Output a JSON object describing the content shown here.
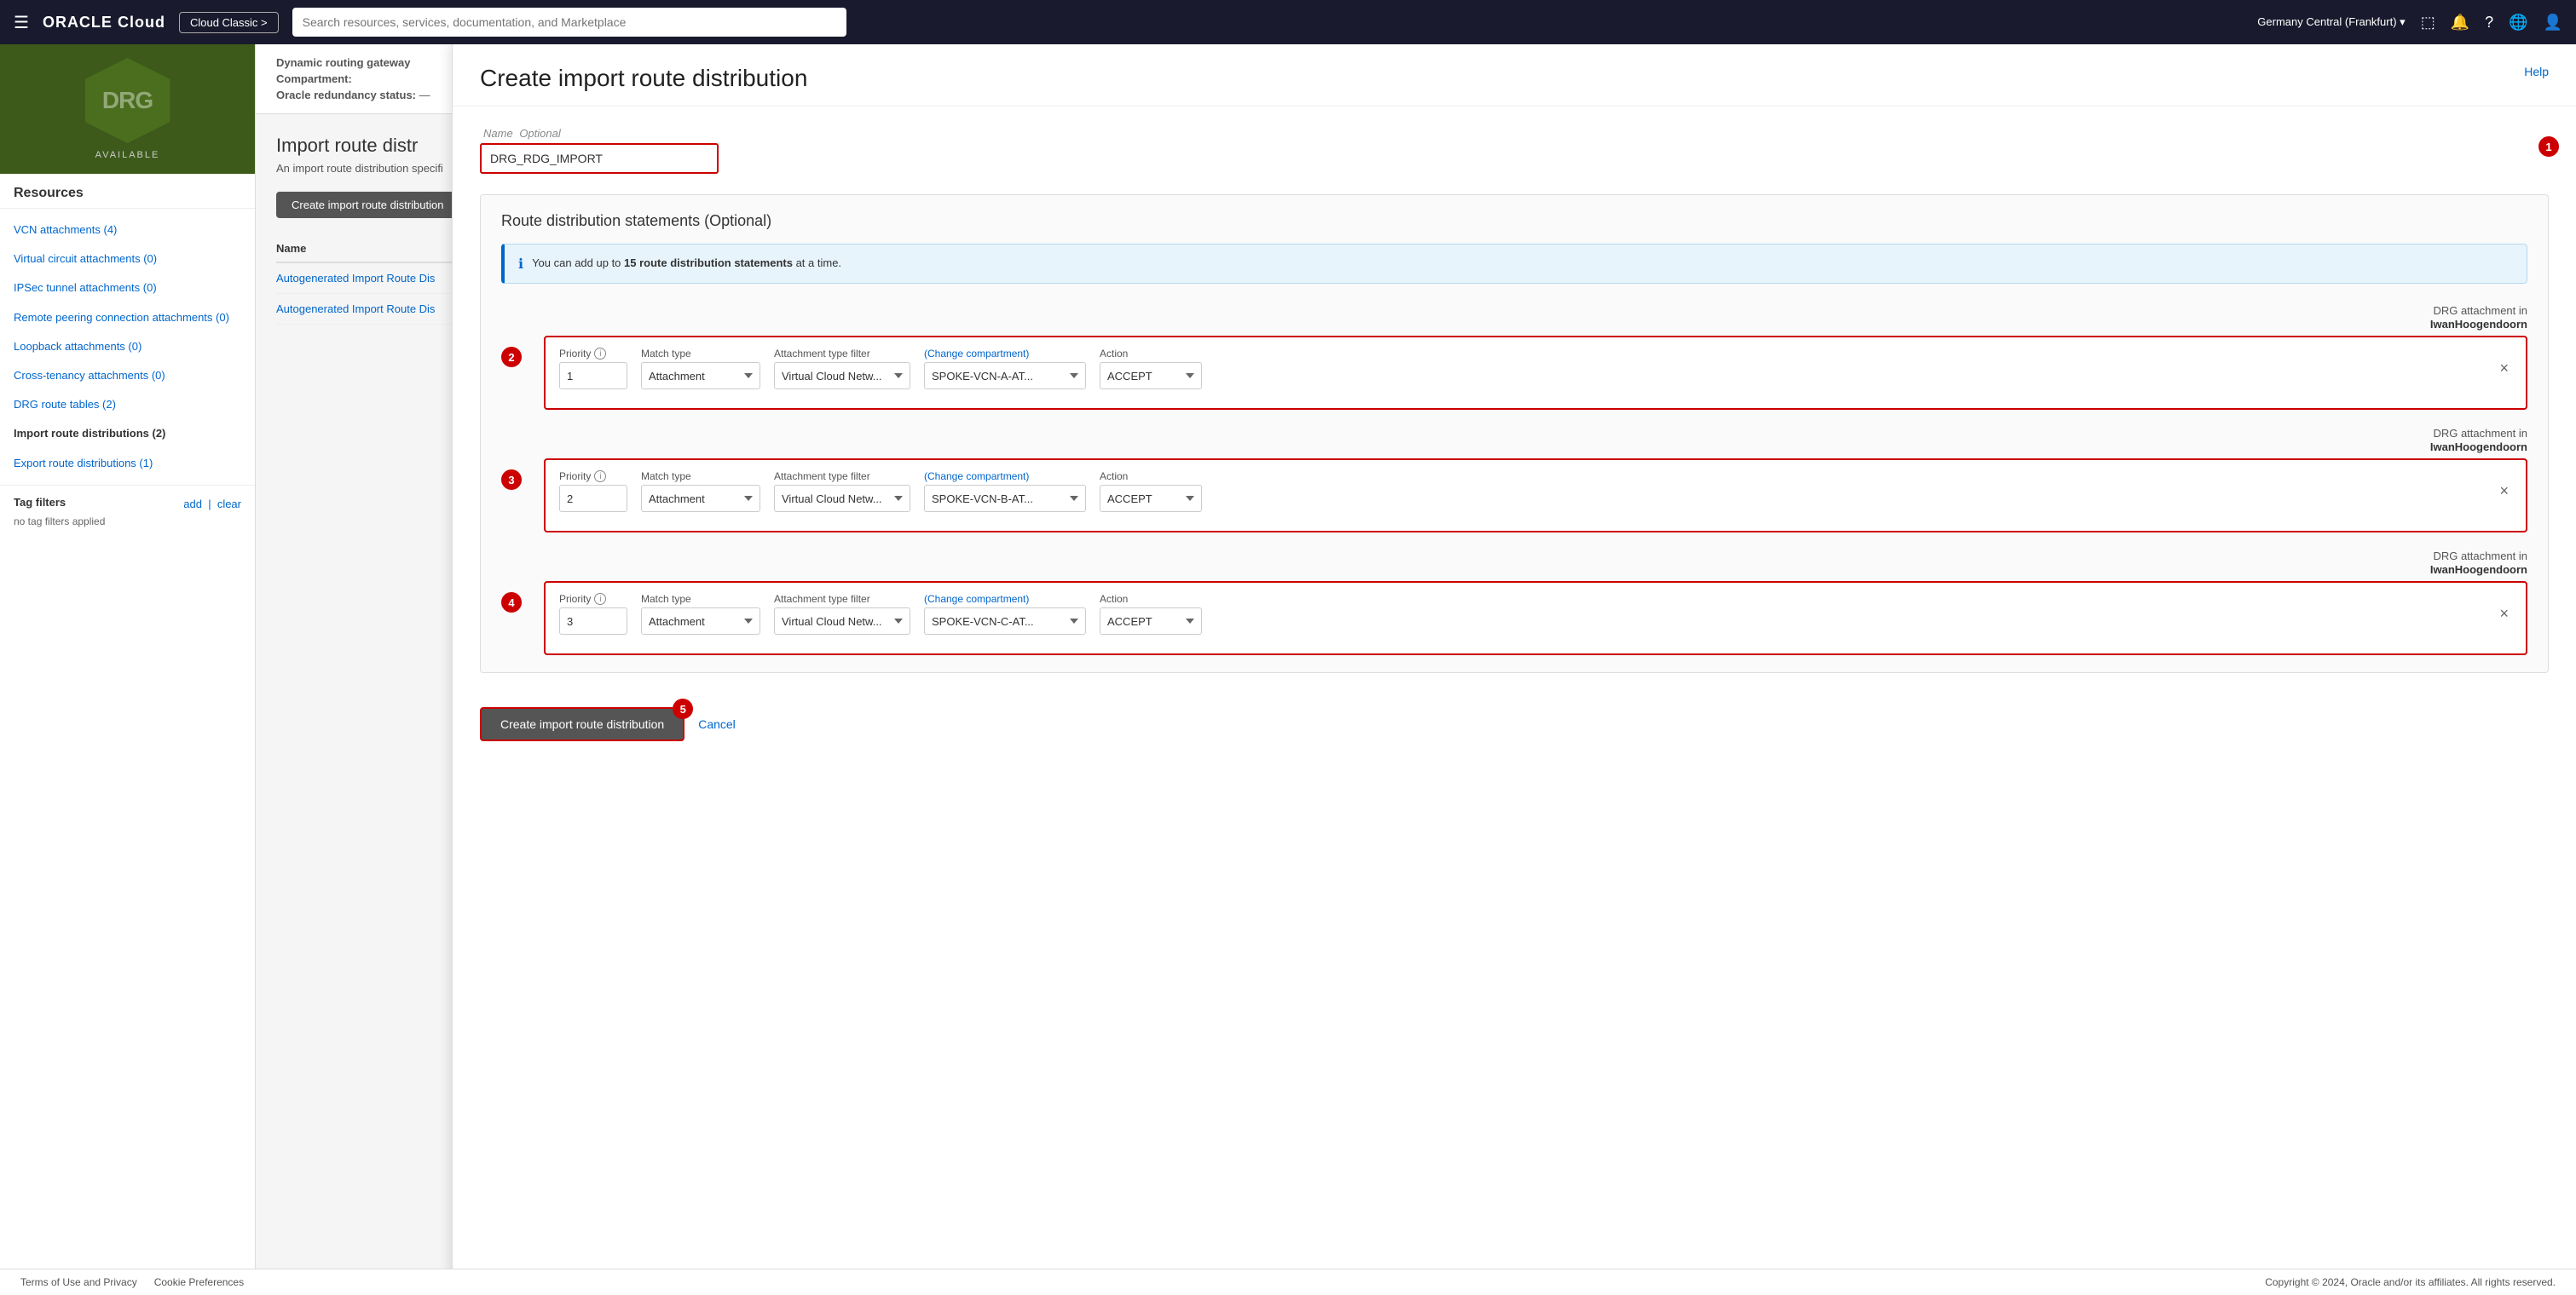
{
  "nav": {
    "hamburger_icon": "☰",
    "logo": "ORACLE",
    "logo_cloud": "Cloud",
    "cloud_classic_btn": "Cloud Classic >",
    "search_placeholder": "Search resources, services, documentation, and Marketplace",
    "region": "Germany Central (Frankfurt)",
    "region_icon": "▾",
    "console_icon": "⬚",
    "bell_icon": "🔔",
    "help_icon": "?",
    "globe_icon": "🌐",
    "user_icon": "👤"
  },
  "sidebar": {
    "drg_text": "DRG",
    "status": "AVAILABLE",
    "resources_title": "Resources",
    "items": [
      {
        "label": "VCN attachments (4)",
        "active": false
      },
      {
        "label": "Virtual circuit attachments (0)",
        "active": false
      },
      {
        "label": "IPSec tunnel attachments (0)",
        "active": false
      },
      {
        "label": "Remote peering connection attachments (0)",
        "active": false
      },
      {
        "label": "Loopback attachments (0)",
        "active": false
      },
      {
        "label": "Cross-tenancy attachments (0)",
        "active": false
      },
      {
        "label": "DRG route tables (2)",
        "active": false
      },
      {
        "label": "Import route distributions (2)",
        "active": true
      },
      {
        "label": "Export route distributions (1)",
        "active": false
      }
    ],
    "tag_filters_title": "Tag filters",
    "tag_add": "add",
    "tag_clear": "clear",
    "tag_note": "no tag filters applied"
  },
  "page": {
    "drg_label": "Dynamic routing gateway",
    "compartment_label": "Compartment:",
    "redundancy_label": "Oracle redundancy status:",
    "import_title": "Import route distr",
    "import_desc": "An import route distribution specifi",
    "create_btn": "Create import route distribution",
    "table_header": "Name",
    "rows": [
      {
        "name": "Autogenerated Import Route Dis"
      },
      {
        "name": "Autogenerated Import Route Dis"
      }
    ]
  },
  "modal": {
    "title": "Create import route distribution",
    "help_link": "Help",
    "name_label": "Name",
    "name_optional": "Optional",
    "name_value": "DRG_RDG_IMPORT",
    "step1": "1",
    "rds_title": "Route distribution statements (Optional)",
    "info_text_before": "You can add up to ",
    "info_bold": "15 route distribution statements",
    "info_text_after": " at a time.",
    "statements": [
      {
        "step_badge": "2",
        "drg_attachment_line1": "DRG attachment in",
        "drg_attachment_line2": "IwanHoogendoorn",
        "priority_label": "Priority",
        "priority_value": "1",
        "match_type_label": "Match type",
        "match_type_value": "Attachment",
        "att_filter_label": "Attachment type filter",
        "att_filter_value": "Virtual Cloud Netw...",
        "change_comp": "(Change compartment)",
        "att_label_above1": "DRG attachment in",
        "att_label_above2": "IwanHoogendoorn",
        "att_value": "SPOKE-VCN-A-AT...",
        "action_label": "Action",
        "action_value": "ACCEPT"
      },
      {
        "step_badge": "3",
        "drg_attachment_line1": "DRG attachment in",
        "drg_attachment_line2": "IwanHoogendoorn",
        "priority_label": "Priority",
        "priority_value": "2",
        "match_type_label": "Match type",
        "match_type_value": "Attachment",
        "att_filter_label": "Attachment type filter",
        "att_filter_value": "Virtual Cloud Netw...",
        "change_comp": "(Change compartment)",
        "att_value": "SPOKE-VCN-B-AT...",
        "action_label": "Action",
        "action_value": "ACCEPT"
      },
      {
        "step_badge": "4",
        "drg_attachment_line1": "DRG attachment in",
        "drg_attachment_line2": "IwanHoogendoorn",
        "priority_label": "Priority",
        "priority_value": "3",
        "match_type_label": "Match type",
        "match_type_value": "Attachment",
        "att_filter_label": "Attachment type filter",
        "att_filter_value": "Virtual Cloud Netw...",
        "change_comp": "(Change compartment)",
        "att_value": "SPOKE-VCN-C-AT...",
        "action_label": "Action",
        "action_value": "ACCEPT"
      }
    ],
    "create_btn": "Create import route distribution",
    "cancel_btn": "Cancel",
    "step5": "5"
  },
  "footer": {
    "terms": "Terms of Use and Privacy",
    "cookie": "Cookie Preferences",
    "copyright": "Copyright © 2024, Oracle and/or its affiliates. All rights reserved."
  }
}
